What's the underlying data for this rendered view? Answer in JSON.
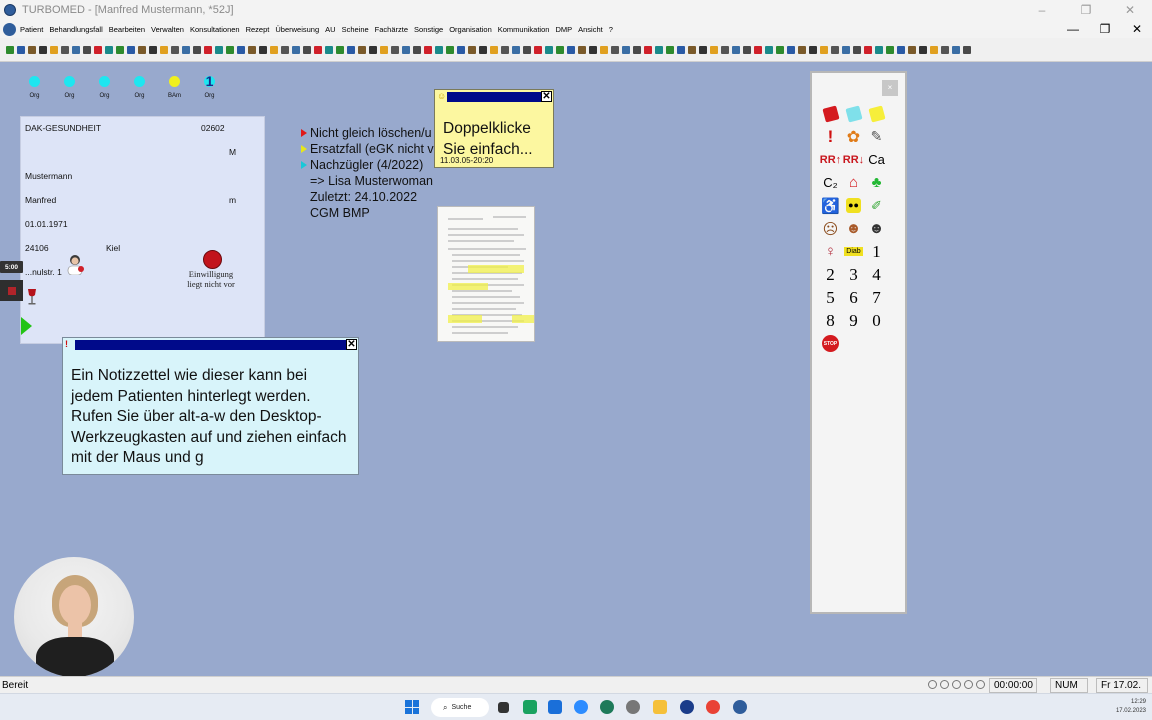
{
  "window": {
    "title": "TURBOMED - [Manfred Mustermann, *52J]",
    "controls": [
      "–",
      "❐",
      "✕"
    ],
    "mdi_controls": [
      "—",
      "❐",
      "✕"
    ]
  },
  "menu": [
    "Patient",
    "Behandlungsfall",
    "Bearbeiten",
    "Verwalten",
    "Konsultationen",
    "Rezept",
    "Überweisung",
    "AU",
    "Scheine",
    "Fachärzte",
    "Sonstige",
    "Organisation",
    "Kommunikation",
    "DMP",
    "Ansicht",
    "?"
  ],
  "status_dots": [
    {
      "label": "Org",
      "color": "#1ee6f0"
    },
    {
      "label": "Org",
      "color": "#1ee6f0"
    },
    {
      "label": "Org",
      "color": "#1ee6f0"
    },
    {
      "label": "Org",
      "color": "#1ee6f0"
    },
    {
      "label": "BAm",
      "color": "#f0f01e"
    },
    {
      "label": "Org",
      "color": "#1ee6f0",
      "glyph": "1"
    }
  ],
  "patient": {
    "insurance": "DAK-GESUNDHEIT",
    "insurance_no": "02602",
    "status": "M",
    "last_name": "Mustermann",
    "first_name": "Manfred",
    "gender": "m",
    "birthdate": "01.01.1971",
    "zip": "24106",
    "city": "Kiel",
    "street": "...nulstr. 1",
    "consent": "Einwilligung liegt nicht vor"
  },
  "side_timer": "5:00",
  "notes": [
    {
      "text": "Nicht gleich löschen/u",
      "marker": "#e01818"
    },
    {
      "text": "Ersatzfall (eGK nicht v",
      "marker": "#e6e61c"
    },
    {
      "text": "Nachzügler (4/2022)",
      "marker": "#18c8d8"
    },
    {
      "text": "=> Lisa Musterwoman",
      "marker": ""
    },
    {
      "text": "Zuletzt: 24.10.2022",
      "marker": ""
    },
    {
      "text": "CGM BMP",
      "marker": ""
    }
  ],
  "sticky_yellow": {
    "mark": "☺",
    "close": "✕",
    "text": "Doppelklicke Sie einfach...",
    "stamp": "11.03.05-20:20"
  },
  "sticky_blue": {
    "mark": "!",
    "close": "✕",
    "text": "Ein Notizzettel wie dieser kann bei jedem Patienten hinterlegt werden. Rufen Sie über alt-a-w den Desktop-Werkzeugkasten auf und ziehen einfach mit der Maus und g"
  },
  "toolbox": {
    "close": "×",
    "labels": {
      "rr_up": "RR↑",
      "rr_down": "RR↓",
      "ca": "Ca",
      "c2": "C₂",
      "diab": "Diab",
      "stop": "STOP"
    },
    "numbers": [
      "1",
      "2",
      "3",
      "4",
      "5",
      "6",
      "7",
      "8",
      "9",
      "0"
    ]
  },
  "statusbar": {
    "left": "Bereit",
    "timer": "00:00:00",
    "num": "NUM",
    "date": "Fr 17.02."
  },
  "taskbar": {
    "search": "Suche",
    "time": "12:29",
    "date": "17.02.2023"
  }
}
